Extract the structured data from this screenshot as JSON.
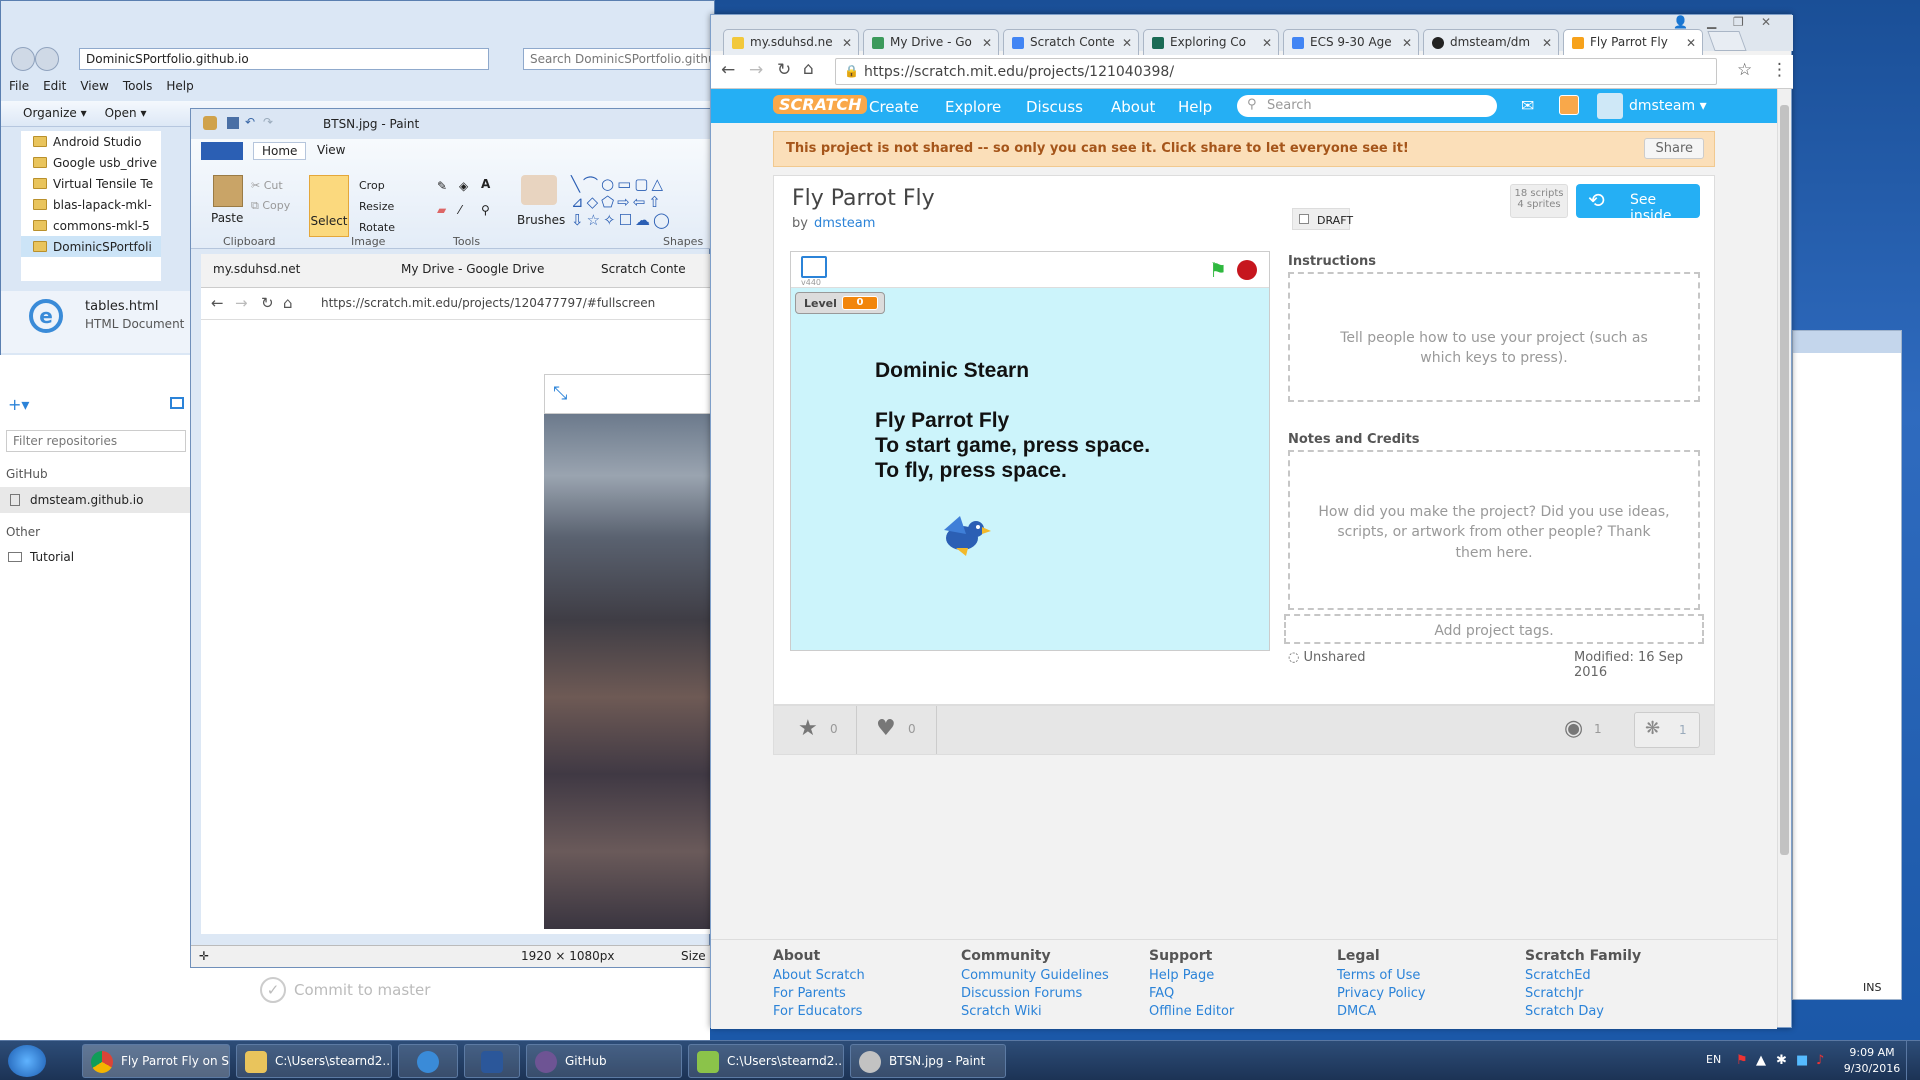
{
  "explorer": {
    "path": "DominicSPortfolio.github.io",
    "search_placeholder": "Search DominicSPortfolio.github.io",
    "menu": [
      "File",
      "Edit",
      "View",
      "Tools",
      "Help"
    ],
    "toolbar": [
      "Organize ▾",
      "Open ▾"
    ],
    "folders": [
      "Android Studio",
      "Google usb_drive",
      "Virtual Tensile Te",
      "blas-lapack-mkl-",
      "commons-mkl-5",
      "DominicSPortfoli"
    ],
    "selected_file": "tables.html",
    "selected_type": "HTML Document"
  },
  "github": {
    "filter_placeholder": "Filter repositories",
    "section_github": "GitHub",
    "repo": "dmsteam.github.io",
    "section_other": "Other",
    "other_repo": "Tutorial",
    "commit_label": "Commit to master"
  },
  "paint": {
    "title": "BTSN.jpg - Paint",
    "tabs": [
      "Home",
      "View"
    ],
    "clipboard": {
      "paste": "Paste",
      "cut": "Cut",
      "copy": "Copy",
      "label": "Clipboard"
    },
    "image": {
      "select": "Select",
      "crop": "Crop",
      "resize": "Resize",
      "rotate": "Rotate",
      "label": "Image"
    },
    "tools_label": "Tools",
    "brushes": "Brushes",
    "shapes_label": "Shapes",
    "inner_tabs": [
      "my.sduhsd.net",
      "My Drive - Google Drive",
      "Scratch Conte"
    ],
    "inner_url": "https://scratch.mit.edu/projects/120477797/#fullscreen",
    "dimensions": "1920 × 1080px",
    "size_label": "Size"
  },
  "chrome": {
    "tabs": [
      "my.sduhsd.ne",
      "My Drive - Go",
      "Scratch Conte",
      "Exploring Co",
      "ECS 9-30 Age",
      "dmsteam/dm",
      "Fly Parrot Fly"
    ],
    "url": "https://scratch.mit.edu/projects/121040398/"
  },
  "scratch": {
    "logo": "SCRATCH",
    "nav": [
      "Create",
      "Explore",
      "Discuss",
      "About",
      "Help"
    ],
    "search_placeholder": "Search",
    "username": "dmsteam ▾",
    "banner": "This project is not shared -- so only you can see it. Click share to let everyone see it!",
    "share_button": "Share",
    "project_title": "Fly Parrot Fly",
    "by": "by",
    "author": "dmsteam",
    "draft": "DRAFT",
    "scripts": "18 scripts",
    "sprites": "4 sprites",
    "see_inside": "See inside",
    "version": "v440",
    "level_label": "Level",
    "level_value": "0",
    "stage_lines": [
      "Dominic Stearn",
      "Fly Parrot Fly",
      "To start game, press space.",
      "To fly, press space."
    ],
    "instructions_label": "Instructions",
    "instructions_placeholder": "Tell people how to use your project (such as which keys to press).",
    "notes_label": "Notes and Credits",
    "notes_placeholder": "How did you make the project? Did you use ideas, scripts, or artwork from other people? Thank them here.",
    "tags_placeholder": "Add project tags.",
    "unshared": "Unshared",
    "modified": "Modified: 16 Sep 2016",
    "stars": "0",
    "loves": "0",
    "views": "1",
    "remixes": "1"
  },
  "footer": [
    {
      "heading": "About",
      "links": [
        "About Scratch",
        "For Parents",
        "For Educators"
      ]
    },
    {
      "heading": "Community",
      "links": [
        "Community Guidelines",
        "Discussion Forums",
        "Scratch Wiki"
      ]
    },
    {
      "heading": "Support",
      "links": [
        "Help Page",
        "FAQ",
        "Offline Editor"
      ]
    },
    {
      "heading": "Legal",
      "links": [
        "Terms of Use",
        "Privacy Policy",
        "DMCA"
      ]
    },
    {
      "heading": "Scratch Family",
      "links": [
        "ScratchEd",
        "ScratchJr",
        "Scratch Day"
      ]
    }
  ],
  "right_window": {
    "ins": "INS"
  },
  "taskbar": {
    "items": [
      "Fly Parrot Fly on S...",
      "C:\\Users\\stearnd2...",
      "",
      "",
      "GitHub",
      "C:\\Users\\stearnd2...",
      "BTSN.jpg - Paint"
    ],
    "lang": "EN",
    "time": "9:09 AM",
    "date": "9/30/2016"
  },
  "colors": {
    "scratch_blue": "#25aff4",
    "banner_bg": "#fbdfb9",
    "stage_bg": "#ccf4fb"
  }
}
